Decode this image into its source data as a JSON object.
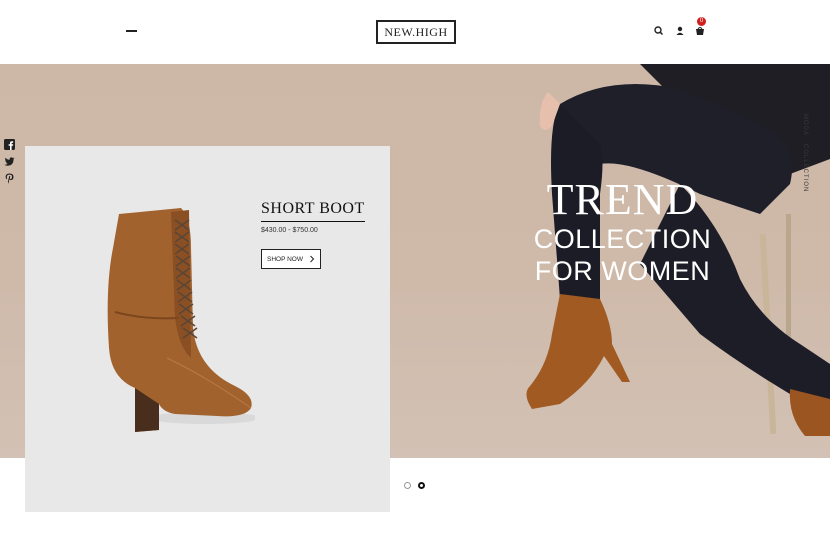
{
  "header": {
    "logo": "NEW.HIGH",
    "cart_count": "0",
    "icons": [
      "menu-icon",
      "search-icon",
      "user-icon",
      "cart-icon"
    ]
  },
  "social": [
    "facebook-icon",
    "twitter-icon",
    "pinterest-icon"
  ],
  "hero": {
    "line1": "TREND",
    "line2": "COLLECTION",
    "line3": "FOR WOMEN",
    "side_text": "MODA  ·  COLLECTION"
  },
  "product": {
    "title": "SHORT BOOT",
    "price": "$430.00 - $750.00",
    "button_label": "SHOP NOW",
    "button_icon": "chevron-right-icon"
  },
  "slider": {
    "count": 2,
    "active": 2
  },
  "colors": {
    "accent": "#d11e1e",
    "hero_bg": "#cdb7a7",
    "card_bg": "#e8e8e9",
    "text": "#222222"
  }
}
